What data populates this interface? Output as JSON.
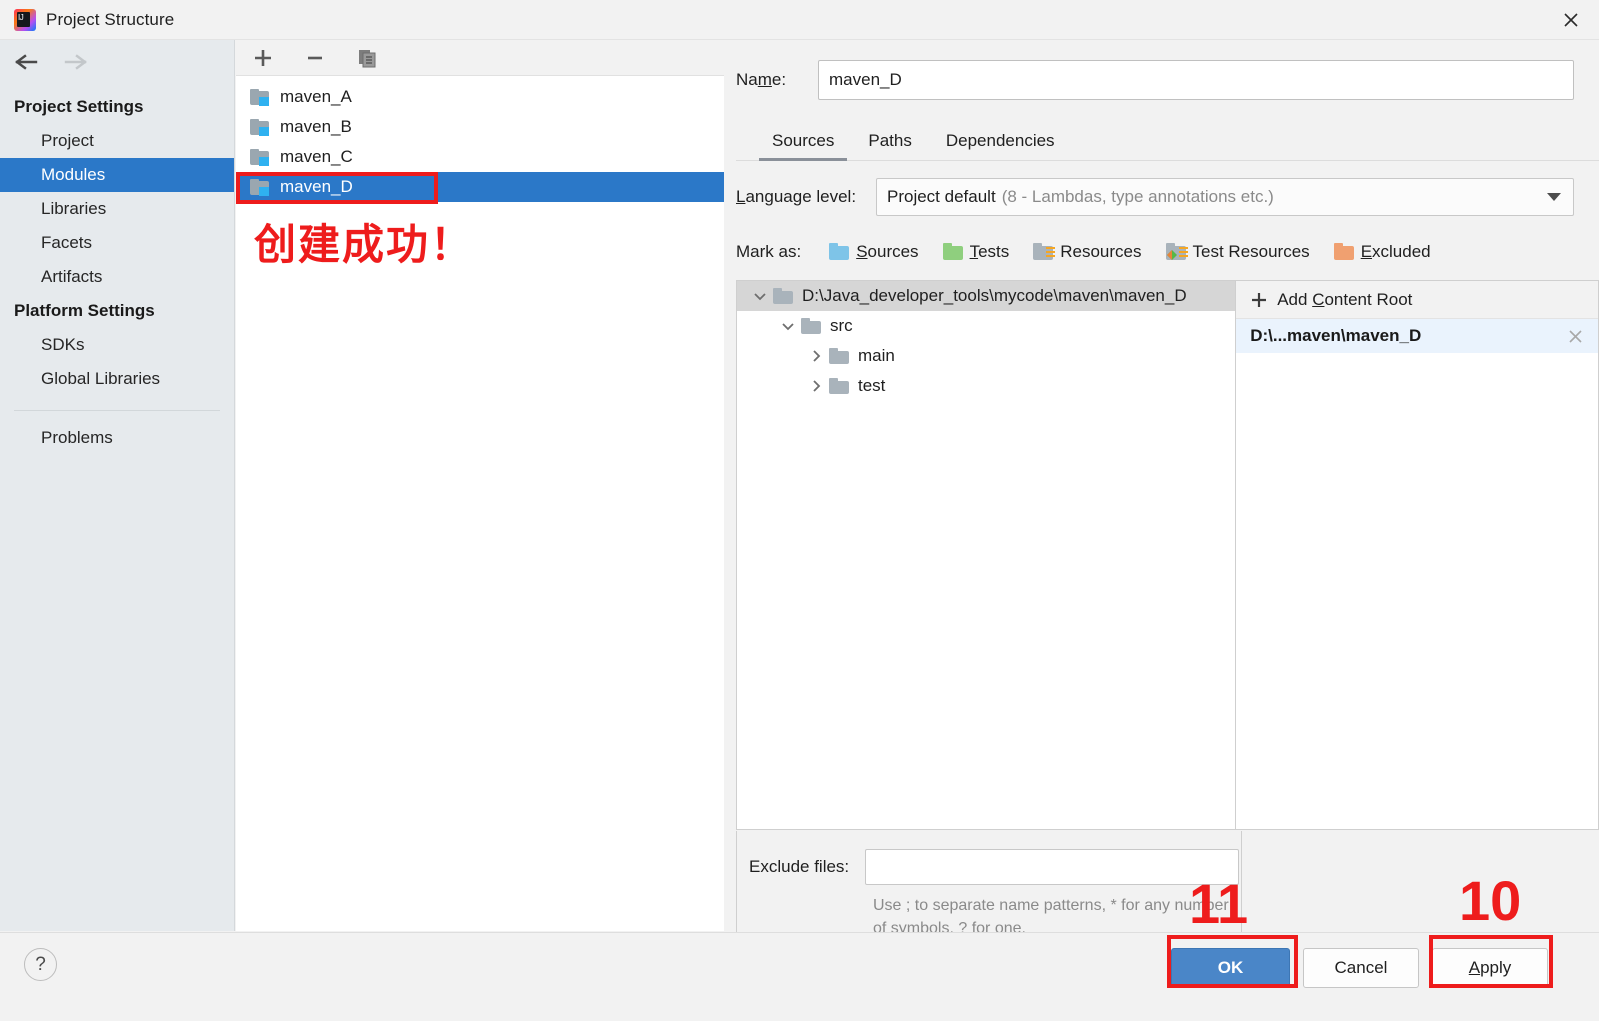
{
  "window": {
    "title": "Project Structure",
    "app_icon": "intellij-idea-logo",
    "close_icon": "close-icon"
  },
  "nav": {
    "back_icon": "arrow-left-icon",
    "forward_icon": "arrow-right-icon"
  },
  "sidebar": {
    "groups": [
      {
        "label": "Project Settings",
        "items": [
          {
            "label": "Project",
            "selected": false
          },
          {
            "label": "Modules",
            "selected": true
          },
          {
            "label": "Libraries",
            "selected": false
          },
          {
            "label": "Facets",
            "selected": false
          },
          {
            "label": "Artifacts",
            "selected": false
          }
        ]
      },
      {
        "label": "Platform Settings",
        "items": [
          {
            "label": "SDKs",
            "selected": false
          },
          {
            "label": "Global Libraries",
            "selected": false
          }
        ]
      }
    ],
    "footer_items": [
      {
        "label": "Problems",
        "selected": false
      }
    ]
  },
  "modules_panel": {
    "toolbar": [
      {
        "icon": "plus-icon",
        "tooltip": "Add"
      },
      {
        "icon": "minus-icon",
        "tooltip": "Remove"
      },
      {
        "icon": "copy-icon",
        "tooltip": "Copy"
      }
    ],
    "modules": [
      {
        "label": "maven_A",
        "selected": false
      },
      {
        "label": "maven_B",
        "selected": false
      },
      {
        "label": "maven_C",
        "selected": false
      },
      {
        "label": "maven_D",
        "selected": true
      }
    ]
  },
  "annotations": {
    "chinese_note": "创建成功！",
    "step_ok": "11",
    "step_apply": "10",
    "color": "#ee1c1c"
  },
  "detail": {
    "name_label": "Name:",
    "name_label_pre": "Na",
    "name_label_accel": "m",
    "name_label_post": "e:",
    "name_value": "maven_D",
    "tabs": [
      {
        "label": "Sources",
        "active": true
      },
      {
        "label": "Paths",
        "active": false
      },
      {
        "label": "Dependencies",
        "active": false
      }
    ],
    "language_level": {
      "label_accel": "L",
      "label_rest": "anguage level:",
      "value": "Project default",
      "value_detail": "(8 - Lambdas, type annotations etc.)",
      "caret_icon": "chevron-down-icon"
    },
    "mark_as": {
      "label": "Mark as:",
      "options": [
        {
          "accel": "S",
          "rest": "ources",
          "icon": "folder-sources-icon",
          "color": "#7ec4e8"
        },
        {
          "accel": "T",
          "rest": "ests",
          "icon": "folder-tests-icon",
          "color": "#8fcf7e"
        },
        {
          "accel": "R",
          "rest": "esources",
          "icon": "folder-resources-icon",
          "color": "#a9b3bb",
          "accel_underlined": false
        },
        {
          "accel": "T",
          "rest": "est Resources",
          "icon": "folder-test-resources-icon",
          "color": "#a9b3bb",
          "accel_underlined": false
        },
        {
          "accel": "E",
          "rest": "xcluded",
          "icon": "folder-excluded-icon",
          "color": "#f0a070"
        }
      ]
    },
    "tree": [
      {
        "label": "D:\\Java_developer_tools\\mycode\\maven\\maven_D",
        "depth": 0,
        "expanded": true,
        "selected": true,
        "has_toggle": true
      },
      {
        "label": "src",
        "depth": 1,
        "expanded": true,
        "selected": false,
        "has_toggle": true
      },
      {
        "label": "main",
        "depth": 2,
        "expanded": false,
        "selected": false,
        "has_toggle": true
      },
      {
        "label": "test",
        "depth": 2,
        "expanded": false,
        "selected": false,
        "has_toggle": true
      }
    ],
    "content_roots": {
      "add_button_pre": "Add ",
      "add_button_accel": "C",
      "add_button_post": "ontent Root",
      "add_icon": "plus-icon",
      "items": [
        {
          "path": "D:\\...maven\\maven_D",
          "remove_icon": "close-icon"
        }
      ]
    },
    "exclude": {
      "label": "Exclude files:",
      "value": "",
      "hint": "Use ; to separate name patterns, * for any number of symbols, ? for one."
    }
  },
  "bottom": {
    "help_icon": "question-mark-icon",
    "ok_label": "OK",
    "cancel_label": "Cancel",
    "apply_accel": "A",
    "apply_rest": "pply"
  }
}
